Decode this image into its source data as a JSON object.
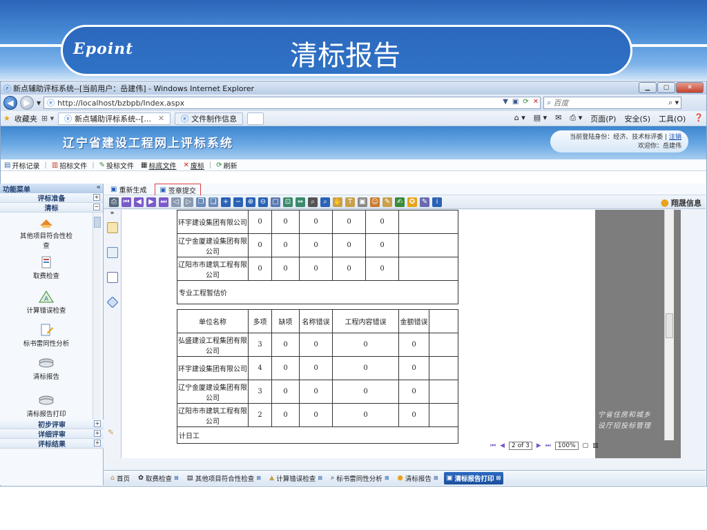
{
  "slide": {
    "logo": "Epoint",
    "title": "清标报告"
  },
  "ie": {
    "window_title": "新点辅助评标系统--[当前用户：岳建伟] - Windows Internet Explorer",
    "url": "http://localhost/bzbpb/Index.aspx",
    "search_placeholder": "百度",
    "favorites": "收藏夹",
    "tab1": "新点辅助评标系统--[...",
    "tab2": "文件制作信息",
    "tools": {
      "page": "页面(P)",
      "safety": "安全(S)",
      "tools": "工具(O)"
    }
  },
  "app": {
    "title": "辽宁省建设工程网上评标系统",
    "user_line1": "当前登陆身份：经济、技术标评委",
    "logout": "注销",
    "user_line2": "欢迎你：岳建伟"
  },
  "menu": [
    "开标记录",
    "招标文件",
    "投标文件",
    "标底文件",
    "废标",
    "刷新"
  ],
  "sidebar": {
    "header": "功能菜单",
    "sections_top": [
      "评标准备",
      "清标"
    ],
    "items": [
      "其他项目符合性检查",
      "取费检查",
      "计算错误检查",
      "标书雷同性分析",
      "清标报告",
      "清标报告打印"
    ],
    "sections_bottom": [
      "初步评审",
      "详细评审",
      "评标结果"
    ]
  },
  "subtoolbar": {
    "regen": "重新生成",
    "submit": "签章提交"
  },
  "report": {
    "brand": "翔晟信息",
    "table1": [
      {
        "name": "环宇建设集团有限公司",
        "vals": [
          "0",
          "0",
          "0",
          "0",
          "0"
        ]
      },
      {
        "name": "辽宁金厦建设集团有限公司",
        "vals": [
          "0",
          "0",
          "0",
          "0",
          "0"
        ]
      },
      {
        "name": "辽阳市市建筑工程有限公司",
        "vals": [
          "0",
          "0",
          "0",
          "0",
          "0"
        ]
      }
    ],
    "section2_title": "专业工程暂估价",
    "table2_headers": [
      "单位名称",
      "多项",
      "缺项",
      "名称错误",
      "工程内容错误",
      "金额错误"
    ],
    "table2": [
      {
        "name": "弘盛建设工程集团有限公司",
        "vals": [
          "3",
          "0",
          "0",
          "0",
          "0"
        ]
      },
      {
        "name": "环宇建设集团有限公司",
        "vals": [
          "4",
          "0",
          "0",
          "0",
          "0"
        ]
      },
      {
        "name": "辽宁金厦建设集团有限公司",
        "vals": [
          "3",
          "0",
          "0",
          "0",
          "0"
        ]
      },
      {
        "name": "辽阳市市建筑工程有限公司",
        "vals": [
          "2",
          "0",
          "0",
          "0",
          "0"
        ]
      }
    ],
    "section3_title": "计日工",
    "watermark_line1": "宁省住房和城乡",
    "watermark_line2": "设厅招投标管理",
    "page": "2 of 3",
    "zoom": "100%"
  },
  "tabs": [
    "首页",
    "取费检查",
    "其他项目符合性检查",
    "计算错误检查",
    "标书雷同性分析",
    "清标报告",
    "清标报告打印"
  ]
}
